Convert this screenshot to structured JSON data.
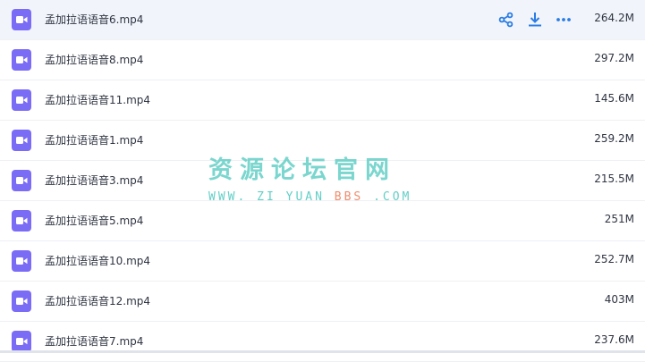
{
  "files": [
    {
      "name": "孟加拉语语音6.mp4",
      "size": "264.2M"
    },
    {
      "name": "孟加拉语语音8.mp4",
      "size": "297.2M"
    },
    {
      "name": "孟加拉语语音11.mp4",
      "size": "145.6M"
    },
    {
      "name": "孟加拉语语音1.mp4",
      "size": "259.2M"
    },
    {
      "name": "孟加拉语语音3.mp4",
      "size": "215.5M"
    },
    {
      "name": "孟加拉语语音5.mp4",
      "size": "251M"
    },
    {
      "name": "孟加拉语语音10.mp4",
      "size": "252.7M"
    },
    {
      "name": "孟加拉语语音12.mp4",
      "size": "403M"
    },
    {
      "name": "孟加拉语语音7.mp4",
      "size": "237.6M"
    }
  ],
  "row_actions": {
    "icons": [
      "share-icon",
      "download-icon",
      "more-icon"
    ]
  },
  "watermark": {
    "title": "资源论坛官网",
    "sub_part1": "WWW. ZI YUAN",
    "sub_part2": "BBS",
    "sub_part3": ".COM"
  },
  "colors": {
    "icon_purple": "#7b6cf6",
    "action_blue": "#2a7be4",
    "hover_row": "#f1f5fb",
    "watermark_teal": "#63cfc6",
    "watermark_orange": "#f08e6d"
  }
}
